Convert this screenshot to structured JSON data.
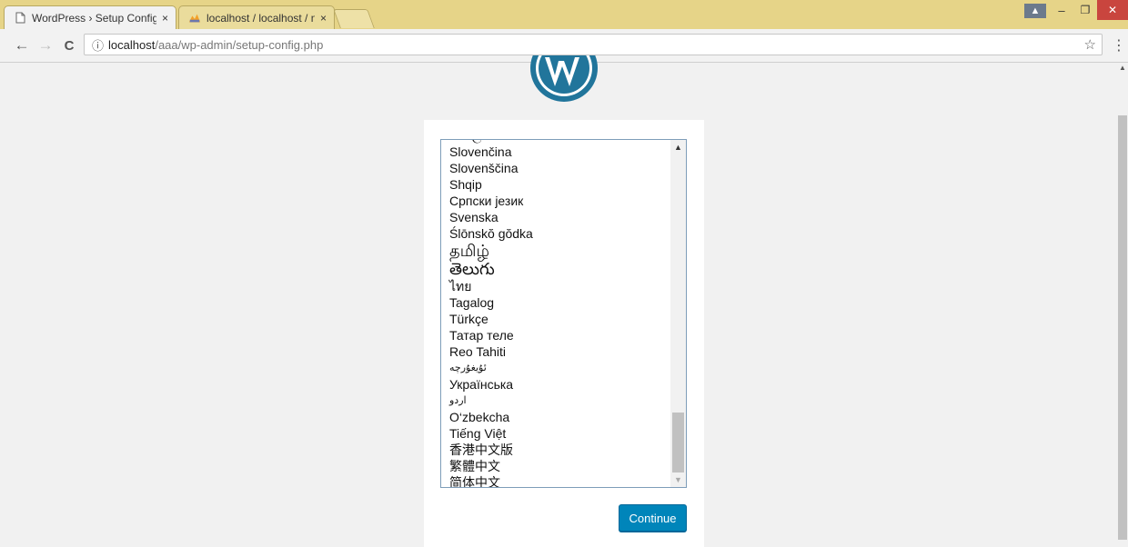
{
  "browser": {
    "tabs": [
      {
        "title": "WordPress › Setup Config",
        "close": "×"
      },
      {
        "title": "localhost / localhost / no",
        "close": "×"
      }
    ],
    "window_controls": {
      "user": "▲",
      "minimize": "–",
      "maximize": "❐",
      "close": "✕"
    },
    "nav": {
      "back": "←",
      "forward": "→",
      "reload": "C"
    },
    "address": {
      "info": "ⓘ",
      "host": "localhost",
      "path": "/aaa/wp-admin/setup-config.php"
    },
    "star": "☆",
    "menu": "⋮"
  },
  "languages": {
    "items": [
      "සිංහල",
      "Slovenčina",
      "Slovenščina",
      "Shqip",
      "Српски језик",
      "Svenska",
      "Ślōnskŏ gŏdka",
      "தமிழ்",
      "తెలుగు",
      "ไทย",
      "Tagalog",
      "Türkçe",
      "Татар теле",
      "Reo Tahiti",
      "ئۇيغۇرچە",
      "Українська",
      "اردو",
      "O‘zbekcha",
      "Tiếng Việt",
      "香港中文版",
      "繁體中文",
      "简体中文"
    ]
  },
  "continue_label": "Continue",
  "colors": {
    "tabstrip": "#e6d488",
    "button": "#0085ba",
    "logo": "#21759b"
  }
}
